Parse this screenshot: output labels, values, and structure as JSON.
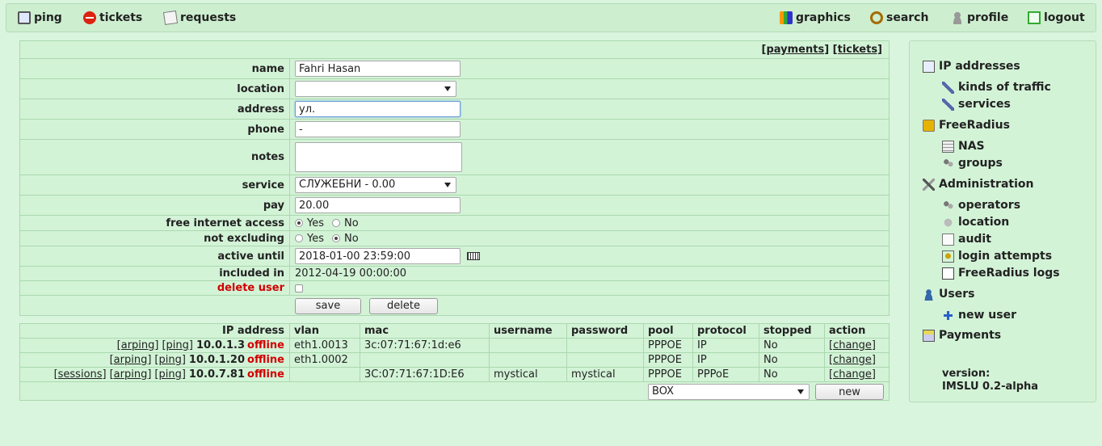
{
  "nav": {
    "ping": "ping",
    "tickets": "tickets",
    "requests": "requests",
    "graphics": "graphics",
    "search": "search",
    "profile": "profile",
    "logout": "logout"
  },
  "form": {
    "links": {
      "payments": "[payments]",
      "tickets": "[tickets]"
    },
    "name": {
      "label": "name",
      "value": "Fahri Hasan"
    },
    "location": {
      "label": "location",
      "value": ""
    },
    "address": {
      "label": "address",
      "value": "ул."
    },
    "phone": {
      "label": "phone",
      "value": "-"
    },
    "notes": {
      "label": "notes",
      "value": ""
    },
    "service": {
      "label": "service",
      "value": "СЛУЖЕБНИ - 0.00"
    },
    "pay": {
      "label": "pay",
      "value": "20.00"
    },
    "free_internet": {
      "label": "free internet access",
      "yes": "Yes",
      "no": "No",
      "selected": "Yes"
    },
    "not_excluding": {
      "label": "not excluding",
      "yes": "Yes",
      "no": "No",
      "selected": "No"
    },
    "active_until": {
      "label": "active until",
      "value": "2018-01-00 23:59:00"
    },
    "included_in": {
      "label": "included in",
      "value": "2012-04-19 00:00:00"
    },
    "delete_user": {
      "label": "delete user"
    },
    "save_label": "save",
    "delete_label": "delete"
  },
  "ip_table": {
    "headers": [
      "IP address",
      "vlan",
      "mac",
      "username",
      "password",
      "pool",
      "protocol",
      "stopped",
      "action"
    ],
    "rows": [
      {
        "links": [
          "[arping]",
          "[ping]"
        ],
        "ip": "10.0.1.3",
        "status": "offline",
        "vlan": "eth1.0013",
        "mac": "3c:07:71:67:1d:e6",
        "username": "",
        "password": "",
        "pool": "PPPOE",
        "protocol": "IP",
        "stopped": "No",
        "action": "[change]"
      },
      {
        "links": [
          "[arping]",
          "[ping]"
        ],
        "ip": "10.0.1.20",
        "status": "offline",
        "vlan": "eth1.0002",
        "mac": "",
        "username": "",
        "password": "",
        "pool": "PPPOE",
        "protocol": "IP",
        "stopped": "No",
        "action": "[change]"
      },
      {
        "links": [
          "[sessions]",
          "[arping]",
          "[ping]"
        ],
        "ip": "10.0.7.81",
        "status": "offline",
        "vlan": "",
        "mac": "3C:07:71:67:1D:E6",
        "username": "mystical",
        "password": "mystical",
        "pool": "PPPOE",
        "protocol": "PPPoE",
        "stopped": "No",
        "action": "[change]"
      }
    ],
    "pool_select": "BOX",
    "new_label": "new"
  },
  "sidebar": {
    "ip_addresses": "IP addresses",
    "kinds_of_traffic": "kinds of traffic",
    "services": "services",
    "freeradius": "FreeRadius",
    "nas": "NAS",
    "groups": "groups",
    "administration": "Administration",
    "operators": "operators",
    "location": "location",
    "audit": "audit",
    "login_attempts": "login attempts",
    "freeradius_logs": "FreeRadius logs",
    "users": "Users",
    "new_user": "new user",
    "payments": "Payments",
    "version_label": "version:",
    "version_value": "IMSLU 0.2-alpha"
  },
  "colors": {
    "offline": "#d20000",
    "delete_label": "#d20000",
    "background": "#d9f5dd"
  }
}
